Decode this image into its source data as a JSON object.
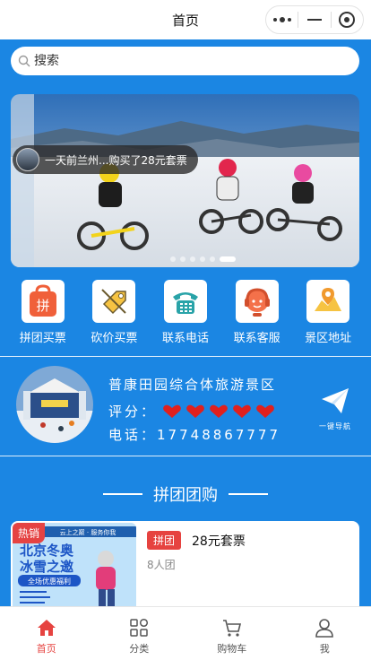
{
  "header": {
    "title": "首页"
  },
  "capsule": {
    "more_icon": "more-dots-icon",
    "minimize_icon": "minus-icon",
    "close_icon": "target-icon"
  },
  "search": {
    "placeholder": "搜索",
    "icon": "search-icon"
  },
  "banner": {
    "notice": "一天前兰州...购买了28元套票",
    "slides": 6,
    "active_index": 5
  },
  "menu": [
    {
      "label": "拼团买票",
      "icon": "group-buy-icon"
    },
    {
      "label": "砍价买票",
      "icon": "bargain-icon"
    },
    {
      "label": "联系电话",
      "icon": "telephone-icon"
    },
    {
      "label": "联系客服",
      "icon": "customer-service-icon"
    },
    {
      "label": "景区地址",
      "icon": "location-icon"
    }
  ],
  "scenic": {
    "name": "普康田园综合体旅游景区",
    "rating_label": "评分：",
    "rating": 5,
    "phone_label": "电话：",
    "phone": "17748867777",
    "nav_label": "一键导航"
  },
  "section": {
    "title": "拼团团购"
  },
  "product": {
    "badge": "热销",
    "tag": "拼团",
    "title": "28元套票",
    "people": "8人团",
    "poster_top": "云上之巅 · 服务你我",
    "poster_line1": "北京冬奥",
    "poster_line2": "冰雪之邀",
    "poster_ribbon": "全场优惠福利"
  },
  "tabbar": [
    {
      "label": "首页",
      "icon": "home-icon",
      "active": true
    },
    {
      "label": "分类",
      "icon": "category-icon",
      "active": false
    },
    {
      "label": "购物车",
      "icon": "cart-icon",
      "active": false
    },
    {
      "label": "我",
      "icon": "user-icon",
      "active": false
    }
  ],
  "colors": {
    "background": "#1b86e3",
    "accent": "#e64340",
    "heart": "#e0201e"
  }
}
